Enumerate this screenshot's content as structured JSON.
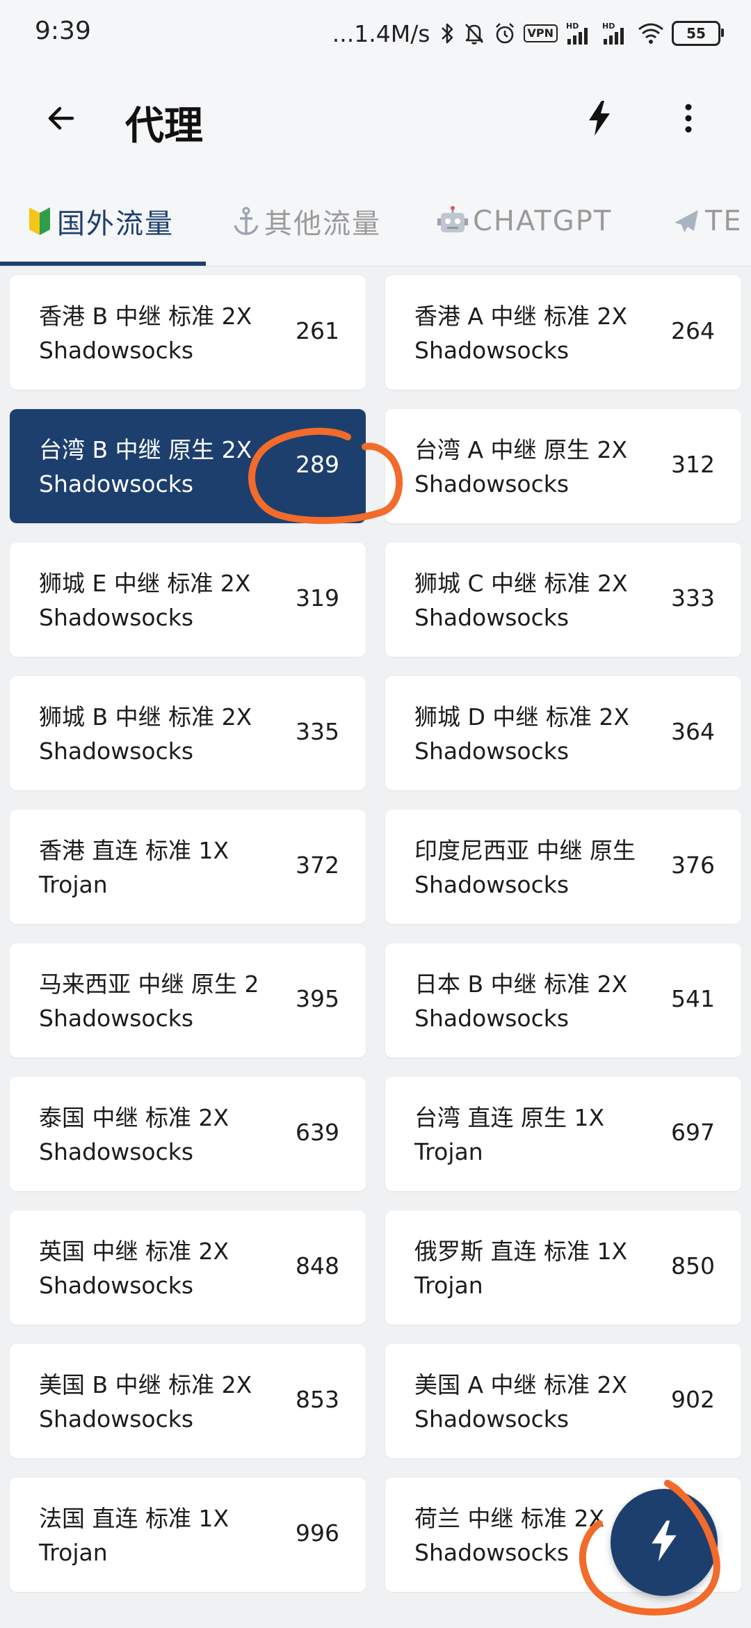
{
  "status_bar": {
    "time": "9:39",
    "net_speed": "...1.4M/s",
    "vpn_label": "VPN",
    "battery_level": "55",
    "icons": [
      "bluetooth-icon",
      "mute-icon",
      "alarm-icon",
      "vpn-icon",
      "signal-icon",
      "signal-icon",
      "wifi-icon",
      "battery-icon"
    ]
  },
  "app_bar": {
    "title": "代理",
    "back_icon": "arrow-left-icon",
    "flash_icon": "lightning-icon",
    "more_icon": "more-vert-icon"
  },
  "tabs": [
    {
      "emoji": "🔰",
      "label": "国外流量",
      "active": true
    },
    {
      "emoji": "⚓",
      "label": "其他流量",
      "active": false
    },
    {
      "emoji": "🤖",
      "label": "CHATGPT",
      "active": false
    },
    {
      "emoji": "✈️",
      "label": "TE",
      "active": false
    }
  ],
  "proxies": [
    {
      "name": "香港 B 中继 标准 2X",
      "protocol": "Shadowsocks",
      "latency": "261",
      "selected": false
    },
    {
      "name": "香港 A 中继 标准 2X",
      "protocol": "Shadowsocks",
      "latency": "264",
      "selected": false
    },
    {
      "name": "台湾 B 中继 原生 2X",
      "protocol": "Shadowsocks",
      "latency": "289",
      "selected": true
    },
    {
      "name": "台湾 A 中继 原生 2X",
      "protocol": "Shadowsocks",
      "latency": "312",
      "selected": false
    },
    {
      "name": "狮城 E 中继 标准 2X",
      "protocol": "Shadowsocks",
      "latency": "319",
      "selected": false
    },
    {
      "name": "狮城 C 中继 标准 2X",
      "protocol": "Shadowsocks",
      "latency": "333",
      "selected": false
    },
    {
      "name": "狮城 B 中继 标准 2X",
      "protocol": "Shadowsocks",
      "latency": "335",
      "selected": false
    },
    {
      "name": "狮城 D 中继 标准 2X",
      "protocol": "Shadowsocks",
      "latency": "364",
      "selected": false
    },
    {
      "name": "香港 直连 标准 1X",
      "protocol": "Trojan",
      "latency": "372",
      "selected": false
    },
    {
      "name": "印度尼西亚 中继 原生",
      "protocol": "Shadowsocks",
      "latency": "376",
      "selected": false
    },
    {
      "name": "马来西亚 中继 原生 2",
      "protocol": "Shadowsocks",
      "latency": "395",
      "selected": false
    },
    {
      "name": "日本 B 中继 标准 2X",
      "protocol": "Shadowsocks",
      "latency": "541",
      "selected": false
    },
    {
      "name": "泰国 中继 标准 2X",
      "protocol": "Shadowsocks",
      "latency": "639",
      "selected": false
    },
    {
      "name": "台湾 直连 原生 1X",
      "protocol": "Trojan",
      "latency": "697",
      "selected": false
    },
    {
      "name": "英国 中继 标准 2X",
      "protocol": "Shadowsocks",
      "latency": "848",
      "selected": false
    },
    {
      "name": "俄罗斯 直连 标准 1X",
      "protocol": "Trojan",
      "latency": "850",
      "selected": false
    },
    {
      "name": "美国 B 中继 标准 2X",
      "protocol": "Shadowsocks",
      "latency": "853",
      "selected": false
    },
    {
      "name": "美国 A 中继 标准 2X",
      "protocol": "Shadowsocks",
      "latency": "902",
      "selected": false
    },
    {
      "name": "法国 直连 标准 1X",
      "protocol": "Trojan",
      "latency": "996",
      "selected": false
    },
    {
      "name": "荷兰 中继 标准 2X",
      "protocol": "Shadowsocks",
      "latency": "",
      "selected": false
    }
  ],
  "fab": {
    "icon": "lightning-icon"
  },
  "colors": {
    "primary": "#1d3f6e",
    "background": "#eff1f3",
    "card": "#ffffff",
    "annotation": "#f26b2a"
  }
}
